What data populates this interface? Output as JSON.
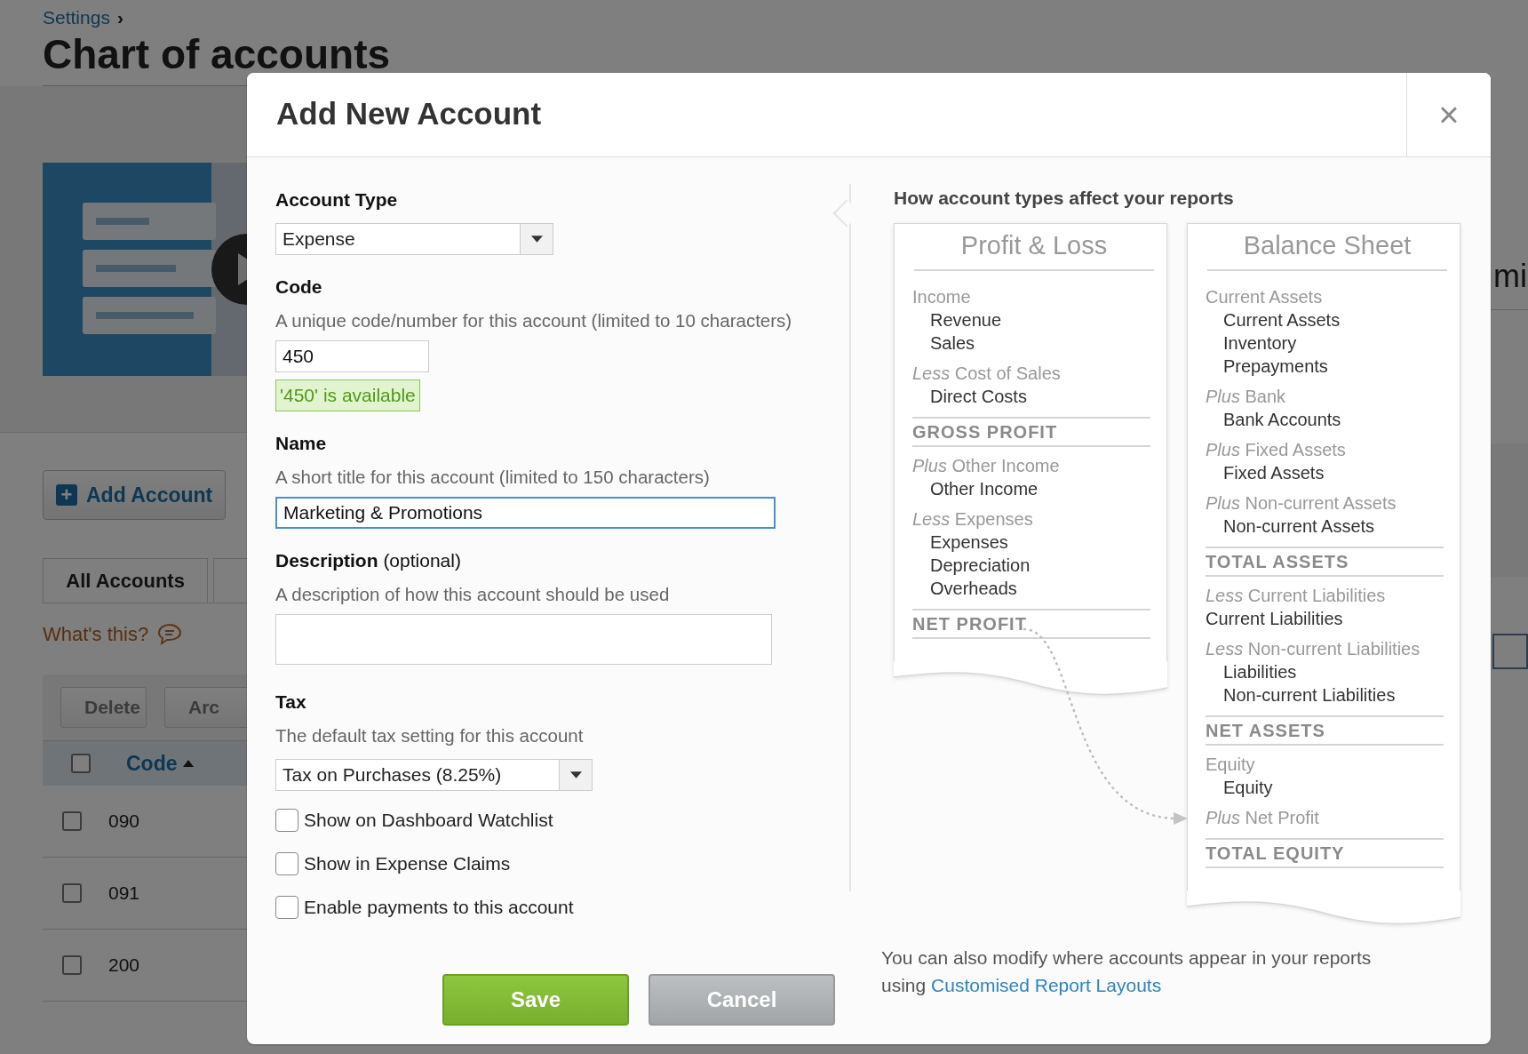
{
  "page": {
    "breadcrumb": "Settings",
    "breadcrumb_separator": "›",
    "title": "Chart of accounts",
    "video": {
      "kind": "picture"
    },
    "add_account_button": {
      "icon": "+",
      "label": "Add Account"
    },
    "tabs": [
      {
        "label": "All Accounts",
        "selected": true
      }
    ],
    "help_link": "What's this?",
    "toolbar_buttons": [
      "Delete",
      "Arc"
    ],
    "table": {
      "header_checkbox": {
        "checked": false
      },
      "columns": [
        "Code"
      ],
      "rows": [
        {
          "code": "090",
          "checked": false
        },
        {
          "code": "091",
          "checked": false
        },
        {
          "code": "200",
          "checked": false
        }
      ]
    },
    "right_text": "mi"
  },
  "dialog": {
    "title": "Add New Account",
    "close": "×",
    "account_type": {
      "label": "Account Type",
      "value": "Expense"
    },
    "code": {
      "label": "Code",
      "help": "A unique code/number for this account (limited to 10 characters)",
      "value": "450",
      "status": "'450' is available"
    },
    "name": {
      "label": "Name",
      "help": "A short title for this account (limited to 150 characters)",
      "value": "Marketing & Promotions",
      "focused": true
    },
    "description": {
      "label": "Description",
      "label_note": "(optional)",
      "help": "A description of how this account should be used"
    },
    "tax": {
      "label": "Tax",
      "help": "The default tax setting for this account",
      "value": "Tax on Purchases (8.25%)"
    },
    "options": [
      {
        "label": "Show on Dashboard Watchlist",
        "checked": false
      },
      {
        "label": "Show in Expense Claims",
        "checked": false
      },
      {
        "label": "Enable payments to this account",
        "checked": false
      }
    ],
    "buttons": [
      {
        "label": "Save",
        "kind": "primary"
      },
      {
        "label": "Cancel",
        "kind": "secondary"
      }
    ],
    "reports": {
      "heading": "How account types affect your reports",
      "cards": [
        {
          "title": "Profit & Loss",
          "lines": [
            {
              "text": "Income",
              "kind": "group"
            },
            {
              "text": "Revenue",
              "kind": "item"
            },
            {
              "text": "Sales",
              "kind": "item"
            },
            {
              "text": "*Less* Cost of Sales",
              "kind": "group"
            },
            {
              "text": "Direct Costs",
              "kind": "item"
            },
            {
              "text": "GROSS PROFIT",
              "kind": "total"
            },
            {
              "text": "*Plus* Other Income",
              "kind": "group"
            },
            {
              "text": "Other Income",
              "kind": "item"
            },
            {
              "text": "*Less* Expenses",
              "kind": "group"
            },
            {
              "text": "Expenses",
              "kind": "item"
            },
            {
              "text": "Depreciation",
              "kind": "item"
            },
            {
              "text": "Overheads",
              "kind": "item"
            },
            {
              "text": "NET PROFIT",
              "kind": "total"
            }
          ]
        },
        {
          "title": "Balance Sheet",
          "lines": [
            {
              "text": "Current Assets",
              "kind": "group"
            },
            {
              "text": "Current Assets",
              "kind": "item"
            },
            {
              "text": "Inventory",
              "kind": "item"
            },
            {
              "text": "Prepayments",
              "kind": "item"
            },
            {
              "text": "*Plus* Bank",
              "kind": "group"
            },
            {
              "text": "Bank Accounts",
              "kind": "item"
            },
            {
              "text": "*Plus* Fixed Assets",
              "kind": "group"
            },
            {
              "text": "Fixed Assets",
              "kind": "item"
            },
            {
              "text": "*Plus* Non-current Assets",
              "kind": "group"
            },
            {
              "text": "Non-current Assets",
              "kind": "item"
            },
            {
              "text": "TOTAL ASSETS",
              "kind": "total"
            },
            {
              "text": "*Less* Current Liabilities",
              "kind": "group"
            },
            {
              "text": "Current Liabilities",
              "kind": "flush"
            },
            {
              "text": "*Less* Non-current Liabilities",
              "kind": "group"
            },
            {
              "text": "Liabilities",
              "kind": "item"
            },
            {
              "text": "Non-current Liabilities",
              "kind": "item"
            },
            {
              "text": "NET ASSETS",
              "kind": "total"
            },
            {
              "text": "Equity",
              "kind": "group"
            },
            {
              "text": "Equity",
              "kind": "item"
            },
            {
              "text": "*Plus* Net Profit",
              "kind": "group"
            },
            {
              "text": "TOTAL EQUITY",
              "kind": "total"
            }
          ]
        }
      ],
      "note": "You can also modify where accounts appear in your reports using",
      "note_link": "Customised Report Layouts"
    }
  }
}
